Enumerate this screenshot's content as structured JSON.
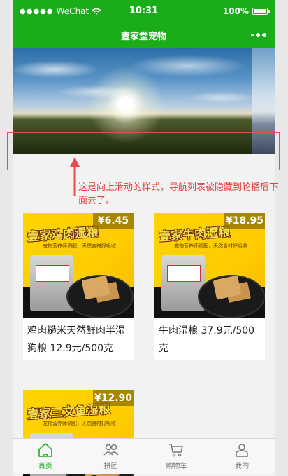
{
  "status_bar": {
    "carrier": "WeChat",
    "time": "10:31",
    "battery": "100%"
  },
  "nav": {
    "title": "壹家堂宠物"
  },
  "annotation": {
    "text": "这是向上滑动的样式，导航列表被隐藏到轮播后下面去了。"
  },
  "products": [
    {
      "name": "鸡肉糙米天然鲜肉半湿狗粮 12.9元/500克",
      "price": "¥6.45",
      "banner": "壹家鸡肉湿粮",
      "sub": "宠物营养师调配，天然食材好吸收"
    },
    {
      "name": "牛肉湿粮 37.9元/500克",
      "price": "¥18.95",
      "banner": "壹家牛肉湿粮",
      "sub": "宠物营养师调配，天然食材好吸收"
    },
    {
      "name": "",
      "price": "¥12.90",
      "banner": "壹家三文鱼湿粮",
      "sub": "宠物营养师调配，天然食材好吸收"
    }
  ],
  "tabs": [
    {
      "label": "首页",
      "icon": "home-icon",
      "active": true
    },
    {
      "label": "拼团",
      "icon": "group-icon",
      "active": false
    },
    {
      "label": "购物车",
      "icon": "cart-icon",
      "active": false
    },
    {
      "label": "我的",
      "icon": "user-icon",
      "active": false
    }
  ],
  "colors": {
    "brand": "#1aad19",
    "annotation": "#e23b3b"
  }
}
